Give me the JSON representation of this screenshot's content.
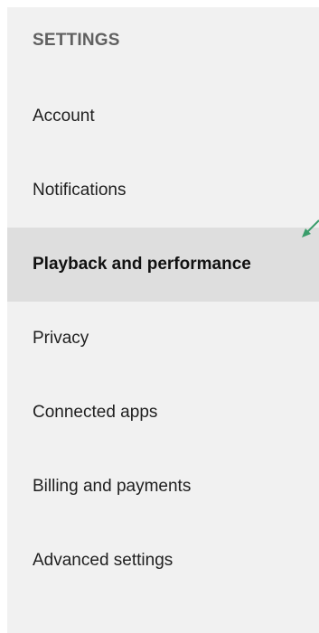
{
  "settings": {
    "heading": "SETTINGS",
    "items": [
      {
        "label": "Account"
      },
      {
        "label": "Notifications"
      },
      {
        "label": "Playback and performance",
        "selected": true
      },
      {
        "label": "Privacy"
      },
      {
        "label": "Connected apps"
      },
      {
        "label": "Billing and payments"
      },
      {
        "label": "Advanced settings"
      }
    ]
  },
  "colors": {
    "panel_bg": "#f1f1f1",
    "selected_bg": "#dedede",
    "heading_text": "#606060",
    "item_text": "#1f1f1f",
    "pointer_arrow": "#3a9d6b"
  },
  "icons": {
    "pointer": "pointer-arrow-icon"
  }
}
